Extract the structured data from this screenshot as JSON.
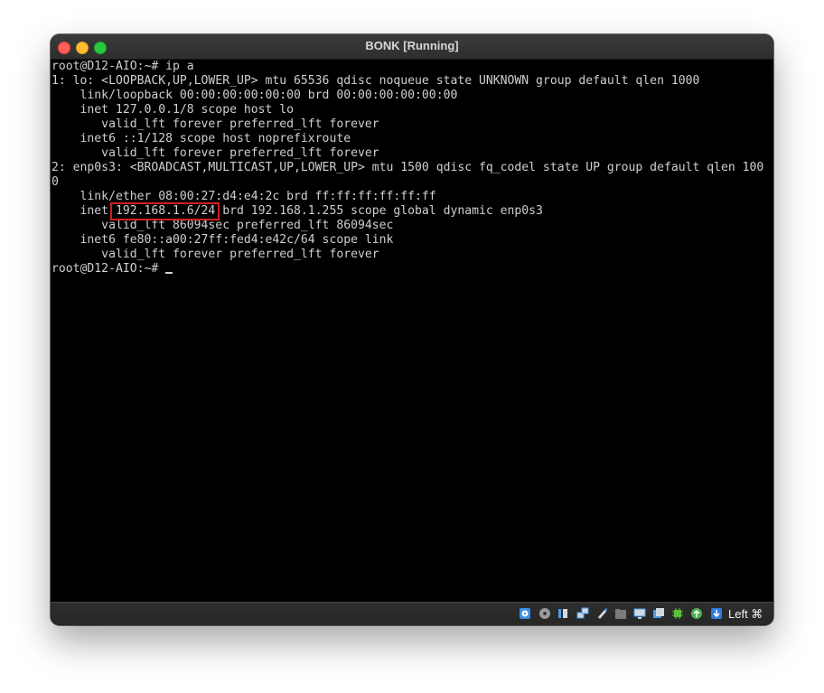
{
  "window": {
    "title": "BONK [Running]"
  },
  "terminal": {
    "lines": [
      "root@D12-AIO:~# ip a",
      "1: lo: <LOOPBACK,UP,LOWER_UP> mtu 65536 qdisc noqueue state UNKNOWN group default qlen 1000",
      "    link/loopback 00:00:00:00:00:00 brd 00:00:00:00:00:00",
      "    inet 127.0.0.1/8 scope host lo",
      "       valid_lft forever preferred_lft forever",
      "    inet6 ::1/128 scope host noprefixroute",
      "       valid_lft forever preferred_lft forever",
      "2: enp0s3: <BROADCAST,MULTICAST,UP,LOWER_UP> mtu 1500 qdisc fq_codel state UP group default qlen 100",
      "0",
      "    link/ether 08:00:27:d4:e4:2c brd ff:ff:ff:ff:ff:ff",
      "    inet 192.168.1.6/24 brd 192.168.1.255 scope global dynamic enp0s3",
      "       valid_lft 86094sec preferred_lft 86094sec",
      "    inet6 fe80::a00:27ff:fed4:e42c/64 scope link",
      "       valid_lft forever preferred_lft forever",
      "root@D12-AIO:~# "
    ],
    "highlighted_value": "192.168.1.6/24"
  },
  "statusbar": {
    "icons": [
      "hard-disk-icon",
      "optical-drive-icon",
      "audio-icon",
      "network-icon",
      "usb-icon",
      "shared-folders-icon",
      "display-icon",
      "recording-icon",
      "cpu-icon",
      "mouse-integration-icon",
      "keyboard-capture-icon"
    ],
    "host_key": "Left ⌘"
  },
  "colors": {
    "highlight": "#d11f1f",
    "terminal_text": "#cfcfcf",
    "terminal_bg": "#000000"
  }
}
